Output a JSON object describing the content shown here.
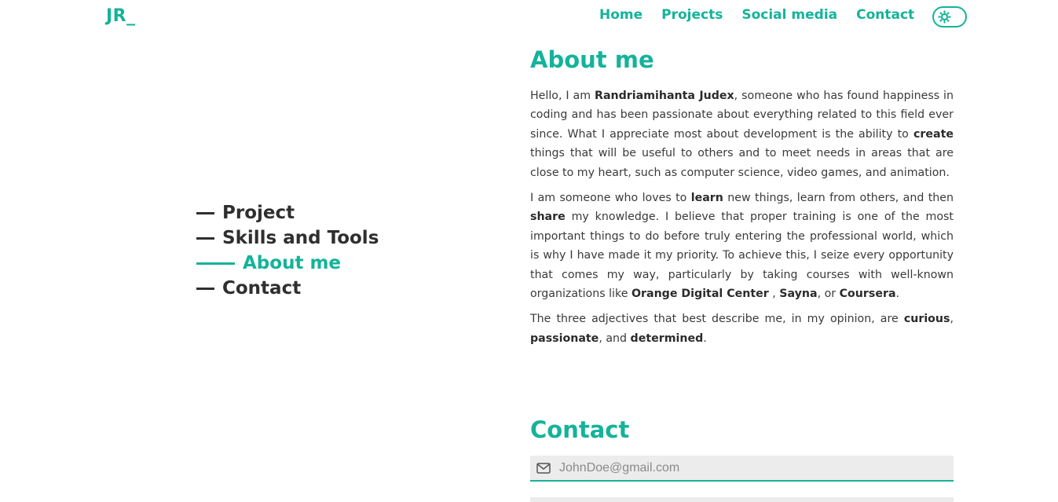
{
  "logo": "JR_",
  "nav": {
    "items": [
      "Home",
      "Projects",
      "Social media",
      "Contact"
    ]
  },
  "theme_toggle_icon": "sun-icon",
  "side_nav": {
    "items": [
      {
        "label": "Project",
        "active": false
      },
      {
        "label": "Skills and Tools",
        "active": false
      },
      {
        "label": "About me",
        "active": true
      },
      {
        "label": "Contact",
        "active": false
      }
    ]
  },
  "about": {
    "title": "About me",
    "p1": {
      "t1": "Hello, I am ",
      "b1": "Randriamihanta Judex",
      "t2": ", someone who has found happiness in coding and has been passionate about everything related to this field ever since. What I appreciate most about development is the ability to ",
      "b2": "create",
      "t3": " things that will be useful to others and to meet needs in areas that are close to my heart, such as computer science, video games, and animation."
    },
    "p2": {
      "t1": "I am someone who loves to ",
      "b1": "learn",
      "t2": " new things, learn from others, and then ",
      "b2": "share",
      "t3": " my knowledge. I believe that proper training is one of the most important things to do before truly entering the professional world, which is why I have made it my priority. To achieve this, I seize every opportunity that comes my way, particularly by taking courses with well-known organizations like ",
      "b3": "Orange Digital Center",
      "t4": " , ",
      "b4": "Sayna",
      "t5": ", or ",
      "b5": "Coursera",
      "t6": "."
    },
    "p3": {
      "t1": "The three adjectives that best describe me, in my opinion, are ",
      "b1": "curious",
      "t2": ", ",
      "b2": "passionate",
      "t3": ", and ",
      "b3": "determined",
      "t4": "."
    }
  },
  "contact": {
    "title": "Contact",
    "email_placeholder": "JohnDoe@gmail.com",
    "email_value": "",
    "email_icon": "envelope-icon"
  },
  "colors": {
    "accent": "#14b39a",
    "text": "#333333",
    "field_bg": "#ececec"
  }
}
